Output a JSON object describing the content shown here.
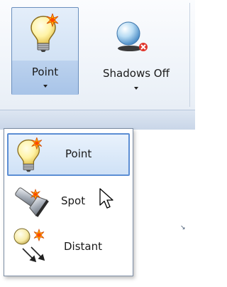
{
  "ribbon": {
    "point_button_label": "Point",
    "shadows_button_label": "Shadows Off"
  },
  "menu": {
    "items": [
      {
        "label": "Point",
        "icon": "point-light-bulb-icon",
        "selected": true
      },
      {
        "label": "Spot",
        "icon": "spotlight-flashlight-icon",
        "selected": false
      },
      {
        "label": "Distant",
        "icon": "distant-light-icon",
        "selected": false
      }
    ]
  },
  "colors": {
    "selection_border": "#5c8ed4",
    "ribbon_footer": "#c9d6e8",
    "bulb_yellow": "#fff3a6",
    "spark_orange": "#ff7a00",
    "shadow_red": "#e0362c"
  }
}
